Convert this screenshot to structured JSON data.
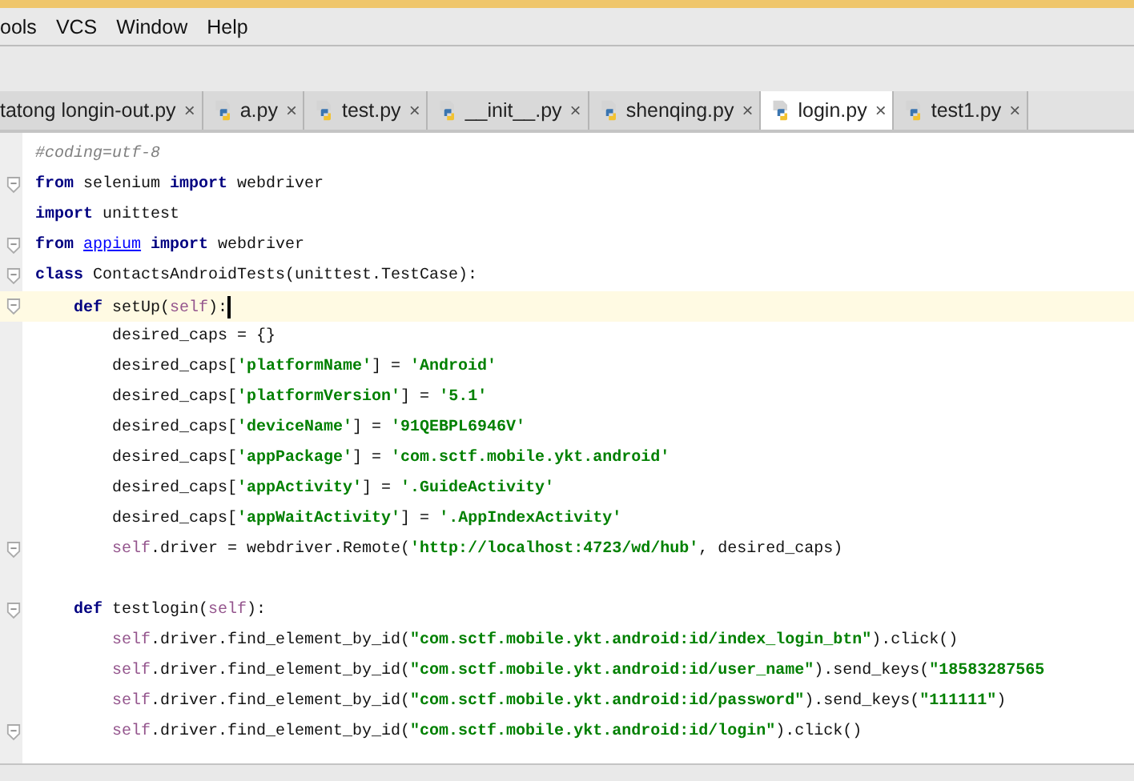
{
  "menu": [
    "ools",
    "VCS",
    "Window",
    "Help"
  ],
  "tabs": [
    {
      "label": "tatong longin-out.py",
      "selected": false,
      "icon": false
    },
    {
      "label": "a.py",
      "selected": false,
      "icon": true
    },
    {
      "label": "test.py",
      "selected": false,
      "icon": true
    },
    {
      "label": "__init__.py",
      "selected": false,
      "icon": true
    },
    {
      "label": "shenqing.py",
      "selected": false,
      "icon": true
    },
    {
      "label": "login.py",
      "selected": true,
      "icon": true
    },
    {
      "label": "test1.py",
      "selected": false,
      "icon": true
    }
  ],
  "close_glyph": "×",
  "code": [
    {
      "fold": false,
      "current": false,
      "tokens": [
        {
          "kind": "comment",
          "t": "#coding=utf-8"
        }
      ]
    },
    {
      "fold": true,
      "current": false,
      "tokens": [
        {
          "kind": "kw",
          "t": "from"
        },
        {
          "kind": "plain",
          "t": " selenium "
        },
        {
          "kind": "kw",
          "t": "import"
        },
        {
          "kind": "plain",
          "t": " webdriver"
        }
      ]
    },
    {
      "fold": false,
      "current": false,
      "tokens": [
        {
          "kind": "kw",
          "t": "import"
        },
        {
          "kind": "plain",
          "t": " unittest"
        }
      ]
    },
    {
      "fold": true,
      "current": false,
      "tokens": [
        {
          "kind": "kw",
          "t": "from "
        },
        {
          "kind": "link",
          "t": "appium"
        },
        {
          "kind": "kw",
          "t": " import"
        },
        {
          "kind": "plain",
          "t": " webdriver"
        }
      ]
    },
    {
      "fold": true,
      "current": false,
      "tokens": [
        {
          "kind": "kw",
          "t": "class"
        },
        {
          "kind": "plain",
          "t": " ContactsAndroidTests(unittest.TestCase):"
        }
      ],
      "children": [
        {
          "fold": true,
          "current": true,
          "tokens": [
            {
              "kind": "kw",
              "t": "def"
            },
            {
              "kind": "plain",
              "t": " setUp("
            },
            {
              "kind": "self",
              "t": "self"
            },
            {
              "kind": "plain",
              "t": "):"
            }
          ],
          "children": [
            {
              "fold": false,
              "current": false,
              "tokens": [
                {
                  "kind": "plain",
                  "t": "desired_caps = {}"
                }
              ]
            },
            {
              "fold": false,
              "current": false,
              "tokens": [
                {
                  "kind": "plain",
                  "t": "desired_caps["
                },
                {
                  "kind": "str",
                  "t": "'platformName'"
                },
                {
                  "kind": "plain",
                  "t": "] = "
                },
                {
                  "kind": "str",
                  "t": "'Android'"
                }
              ]
            },
            {
              "fold": false,
              "current": false,
              "tokens": [
                {
                  "kind": "plain",
                  "t": "desired_caps["
                },
                {
                  "kind": "str",
                  "t": "'platformVersion'"
                },
                {
                  "kind": "plain",
                  "t": "] = "
                },
                {
                  "kind": "str",
                  "t": "'5.1'"
                }
              ]
            },
            {
              "fold": false,
              "current": false,
              "tokens": [
                {
                  "kind": "plain",
                  "t": "desired_caps["
                },
                {
                  "kind": "str",
                  "t": "'deviceName'"
                },
                {
                  "kind": "plain",
                  "t": "] = "
                },
                {
                  "kind": "str",
                  "t": "'91QEBPL6946V'"
                }
              ]
            },
            {
              "fold": false,
              "current": false,
              "tokens": [
                {
                  "kind": "plain",
                  "t": "desired_caps["
                },
                {
                  "kind": "str",
                  "t": "'appPackage'"
                },
                {
                  "kind": "plain",
                  "t": "] = "
                },
                {
                  "kind": "str",
                  "t": "'com.sctf.mobile.ykt.android'"
                }
              ]
            },
            {
              "fold": false,
              "current": false,
              "tokens": [
                {
                  "kind": "plain",
                  "t": "desired_caps["
                },
                {
                  "kind": "str",
                  "t": "'appActivity'"
                },
                {
                  "kind": "plain",
                  "t": "] = "
                },
                {
                  "kind": "str",
                  "t": "'.GuideActivity'"
                }
              ]
            },
            {
              "fold": false,
              "current": false,
              "tokens": [
                {
                  "kind": "plain",
                  "t": "desired_caps["
                },
                {
                  "kind": "str",
                  "t": "'appWaitActivity'"
                },
                {
                  "kind": "plain",
                  "t": "] = "
                },
                {
                  "kind": "str",
                  "t": "'.AppIndexActivity'"
                }
              ]
            },
            {
              "fold": true,
              "current": false,
              "tokens": [
                {
                  "kind": "self",
                  "t": "self"
                },
                {
                  "kind": "plain",
                  "t": ".driver = webdriver.Remote("
                },
                {
                  "kind": "str",
                  "t": "'http://localhost:4723/wd/hub'"
                },
                {
                  "kind": "plain",
                  "t": ", desired_caps)"
                }
              ]
            }
          ]
        },
        {
          "fold": true,
          "current": false,
          "blank_before": true,
          "tokens": [
            {
              "kind": "kw",
              "t": "def"
            },
            {
              "kind": "plain",
              "t": " testlogin("
            },
            {
              "kind": "self",
              "t": "self"
            },
            {
              "kind": "plain",
              "t": "):"
            }
          ],
          "children": [
            {
              "fold": false,
              "current": false,
              "tokens": [
                {
                  "kind": "self",
                  "t": "self"
                },
                {
                  "kind": "plain",
                  "t": ".driver.find_element_by_id("
                },
                {
                  "kind": "str",
                  "t": "\"com.sctf.mobile.ykt.android:id/index_login_btn\""
                },
                {
                  "kind": "plain",
                  "t": ").click()"
                }
              ]
            },
            {
              "fold": false,
              "current": false,
              "tokens": [
                {
                  "kind": "self",
                  "t": "self"
                },
                {
                  "kind": "plain",
                  "t": ".driver.find_element_by_id("
                },
                {
                  "kind": "str",
                  "t": "\"com.sctf.mobile.ykt.android:id/user_name\""
                },
                {
                  "kind": "plain",
                  "t": ").send_keys("
                },
                {
                  "kind": "str",
                  "t": "\"18583287565"
                }
              ]
            },
            {
              "fold": false,
              "current": false,
              "tokens": [
                {
                  "kind": "self",
                  "t": "self"
                },
                {
                  "kind": "plain",
                  "t": ".driver.find_element_by_id("
                },
                {
                  "kind": "str",
                  "t": "\"com.sctf.mobile.ykt.android:id/password\""
                },
                {
                  "kind": "plain",
                  "t": ").send_keys("
                },
                {
                  "kind": "str",
                  "t": "\"111111\""
                },
                {
                  "kind": "plain",
                  "t": ")"
                }
              ]
            },
            {
              "fold": true,
              "current": false,
              "tokens": [
                {
                  "kind": "self",
                  "t": "self"
                },
                {
                  "kind": "plain",
                  "t": ".driver.find_element_by_id("
                },
                {
                  "kind": "str",
                  "t": "\"com.sctf.mobile.ykt.android:id/login\""
                },
                {
                  "kind": "plain",
                  "t": ").click()"
                }
              ]
            }
          ]
        }
      ]
    }
  ]
}
